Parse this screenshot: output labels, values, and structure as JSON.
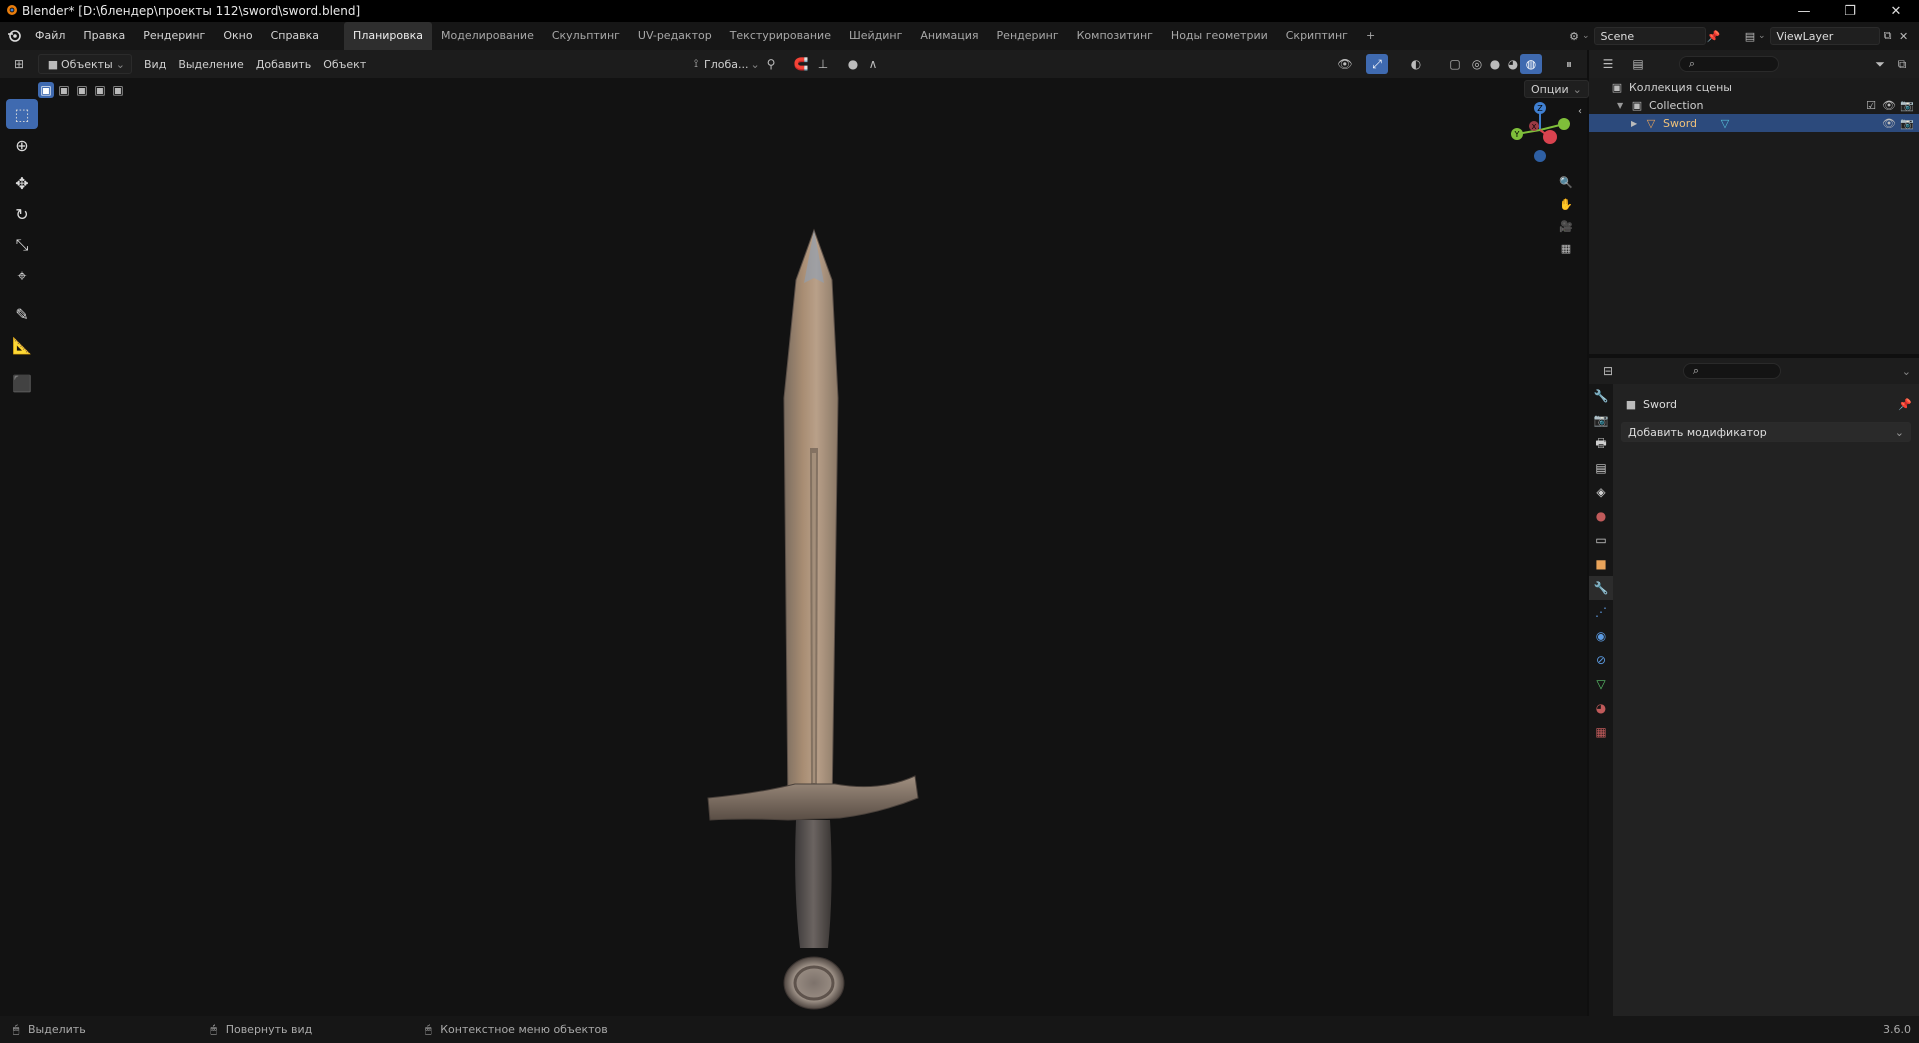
{
  "window": {
    "title": "Blender* [D:\\блендер\\проекты 112\\sword\\sword.blend]",
    "minimize": "—",
    "maximize": "❐",
    "close": "✕"
  },
  "menu": {
    "items": [
      "Файл",
      "Правка",
      "Рендеринг",
      "Окно",
      "Справка"
    ],
    "workspaces": [
      "Планировка",
      "Моделирование",
      "Скульптинг",
      "UV-редактор",
      "Текстурирование",
      "Шейдинг",
      "Анимация",
      "Рендеринг",
      "Композитинг",
      "Ноды геометрии",
      "Скриптинг"
    ],
    "active_workspace_index": 0,
    "add_workspace": "+",
    "scene": "Scene",
    "view_layer": "ViewLayer"
  },
  "viewport_header": {
    "mode": "Объекты",
    "menus": [
      "Вид",
      "Выделение",
      "Добавить",
      "Объект"
    ],
    "transform_orientation": "Глоба...",
    "options": "Опции"
  },
  "outliner": {
    "root": "Коллекция сцены",
    "collection": "Collection",
    "object": "Sword"
  },
  "properties": {
    "object_name": "Sword",
    "add_modifier": "Добавить модификатор"
  },
  "statusbar": {
    "select": "Выделить",
    "rotate": "Повернуть вид",
    "context": "Контекстное меню объектов",
    "version": "3.6.0"
  },
  "colors": {
    "accent": "#3f6ab0",
    "selection": "#2c4a7c",
    "axis_x": "#d9434f",
    "axis_y": "#7fbf3a",
    "axis_z": "#3f7fd1"
  }
}
